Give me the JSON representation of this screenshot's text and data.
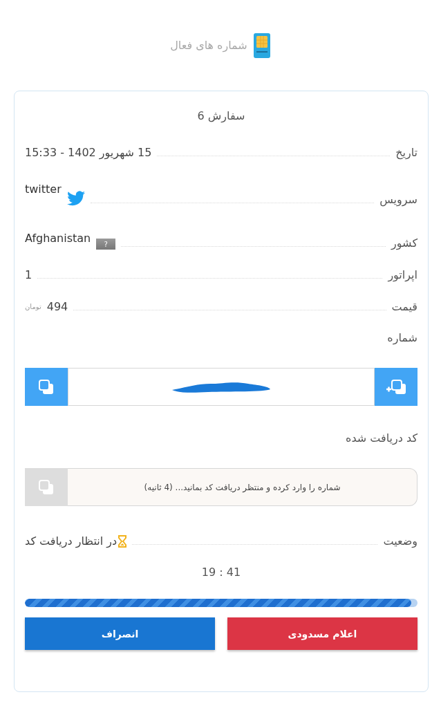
{
  "header": {
    "title": "شماره های فعال"
  },
  "order": {
    "title": "سفارش 6",
    "details": [
      {
        "kind": "text",
        "label": "تاریخ",
        "value": "15 شهریور 1402 - 15:33"
      },
      {
        "kind": "service",
        "label": "سرویس",
        "value": "twitter"
      },
      {
        "kind": "country",
        "label": "کشور",
        "value": "Afghanistan",
        "flag": "?"
      },
      {
        "kind": "text",
        "label": "اپراتور",
        "value": "1"
      },
      {
        "kind": "price",
        "label": "قیمت",
        "value": "494",
        "unit": "تومان"
      }
    ],
    "number": {
      "label": "شماره",
      "redacted": true
    },
    "code": {
      "label": "کد دریافت شده",
      "message": "شماره را وارد کرده و منتظر دریافت کد بمانید... (4 ثانیه)",
      "copy_disabled": true
    },
    "status": {
      "label": "وضعیت",
      "value": "در انتظار دریافت کد"
    },
    "timer": "19 : 41",
    "progress": {
      "level": 0.985
    },
    "buttons": [
      {
        "kind": "danger",
        "label": "اعلام مسدودی"
      },
      {
        "kind": "primary",
        "label": "انصراف"
      }
    ]
  }
}
